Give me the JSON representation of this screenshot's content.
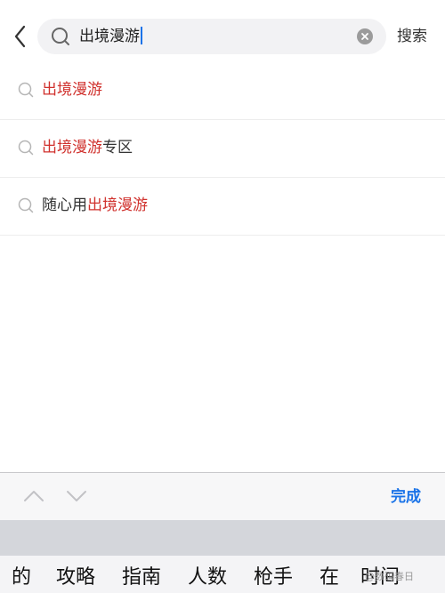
{
  "search": {
    "query": "出境漫游",
    "search_button_label": "搜索"
  },
  "suggestions": [
    {
      "prefix": "",
      "highlight": "出境漫游",
      "suffix": ""
    },
    {
      "prefix": "",
      "highlight": "出境漫游",
      "suffix": "专区"
    },
    {
      "prefix": "随心用",
      "highlight": "出境漫游",
      "suffix": ""
    }
  ],
  "keyboard": {
    "done_label": "完成",
    "candidates": [
      "的",
      "攻略",
      "指南",
      "人数",
      "枪手",
      "在",
      "时间"
    ]
  },
  "watermark": "@数码春日",
  "colors": {
    "highlight": "#d0312d",
    "accent": "#1a73e8"
  },
  "icons": [
    "back-arrow-icon",
    "search-icon",
    "clear-icon",
    "chevron-up-icon",
    "chevron-down-icon"
  ]
}
